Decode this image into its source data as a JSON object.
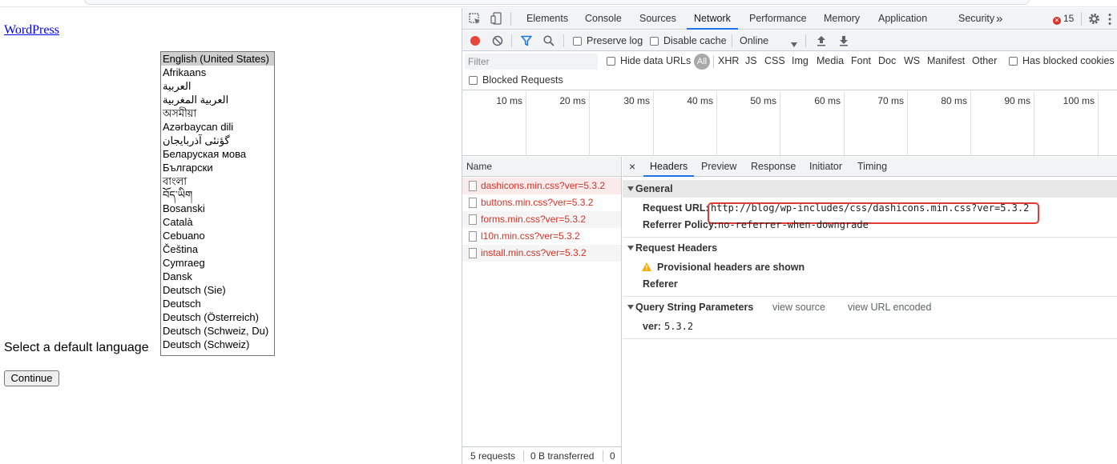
{
  "page": {
    "wordpress_link": "WordPress",
    "language_label": "Select a default language",
    "languages": [
      "English (United States)",
      "Afrikaans",
      "العربية",
      "العربية المغربية",
      "অসমীয়া",
      "Azərbaycan dili",
      "گؤنئی آذربایجان",
      "Беларуская мова",
      "Български",
      "বাংলা",
      "བོད་ཡིག",
      "Bosanski",
      "Català",
      "Cebuano",
      "Čeština",
      "Cymraeg",
      "Dansk",
      "Deutsch (Sie)",
      "Deutsch",
      "Deutsch (Österreich)",
      "Deutsch (Schweiz, Du)",
      "Deutsch (Schweiz)"
    ],
    "selected_language": "English (United States)",
    "continue_label": "Continue"
  },
  "devtools": {
    "tabs": [
      "Elements",
      "Console",
      "Sources",
      "Network",
      "Performance",
      "Memory",
      "Application",
      "Security"
    ],
    "more_tabs_glyph": "»",
    "active_tab": "Network",
    "error_count": "15",
    "toolbar": {
      "preserve_log": "Preserve log",
      "disable_cache": "Disable cache",
      "throttle": "Online"
    },
    "filter": {
      "placeholder": "Filter",
      "hide_data_urls": "Hide data URLs",
      "all": "All",
      "types": [
        "XHR",
        "JS",
        "CSS",
        "Img",
        "Media",
        "Font",
        "Doc",
        "WS",
        "Manifest",
        "Other"
      ],
      "has_blocked_cookies": "Has blocked cookies",
      "blocked_requests": "Blocked Requests"
    },
    "timeline_ticks": [
      "10 ms",
      "20 ms",
      "30 ms",
      "40 ms",
      "50 ms",
      "60 ms",
      "70 ms",
      "80 ms",
      "90 ms",
      "100 ms"
    ],
    "requests": {
      "column": "Name",
      "rows": [
        "dashicons.min.css?ver=5.3.2",
        "buttons.min.css?ver=5.3.2",
        "forms.min.css?ver=5.3.2",
        "l10n.min.css?ver=5.3.2",
        "install.min.css?ver=5.3.2"
      ],
      "summary_requests": "5 requests",
      "summary_transferred": "0 B transferred",
      "summary_extra": "0"
    },
    "detail": {
      "close_glyph": "×",
      "tabs": [
        "Headers",
        "Preview",
        "Response",
        "Initiator",
        "Timing"
      ],
      "active_tab": "Headers",
      "general": {
        "title": "General",
        "request_url_key": "Request URL:",
        "request_url": "http://blog/wp-includes/css/dashicons.min.css?ver=5.3.2",
        "referrer_policy_key": "Referrer Policy:",
        "referrer_policy": "no-referrer-when-downgrade"
      },
      "request_headers": {
        "title": "Request Headers",
        "warning": "Provisional headers are shown",
        "referer_key": "Referer"
      },
      "query": {
        "title": "Query String Parameters",
        "view_source": "view source",
        "view_url_encoded": "view URL encoded",
        "param_key": "ver:",
        "param_value": "5.3.2"
      }
    }
  },
  "colors": {
    "accent": "#1a73e8",
    "error": "#d93025",
    "highlight_box": "#e53935"
  }
}
